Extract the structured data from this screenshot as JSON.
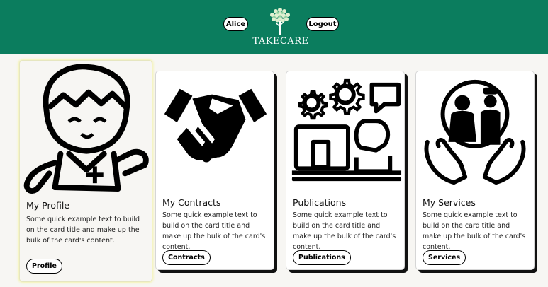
{
  "header": {
    "user_label": "Alice",
    "logout_label": "Logout",
    "brand": "TAKECARE",
    "bg_color": "#0b7d5e"
  },
  "cards": [
    {
      "title": "My Profile",
      "text": "Some quick example text to build on the card title and make up the bulk of the card's content.",
      "button": "Profile",
      "icon": "nurse-icon"
    },
    {
      "title": "My Contracts",
      "text": "Some quick example text to build on the card title and make up the bulk of the card's content.",
      "button": "Contracts",
      "icon": "handshake-icon"
    },
    {
      "title": "Publications",
      "text": "Some quick example text to build on the card title and make up the bulk of the card's content.",
      "button": "Publications",
      "icon": "computer-worker-icon"
    },
    {
      "title": "My Services",
      "text": "Some quick example text to build on the card title and make up the bulk of the card's content.",
      "button": "Services",
      "icon": "elderly-care-icon"
    }
  ]
}
